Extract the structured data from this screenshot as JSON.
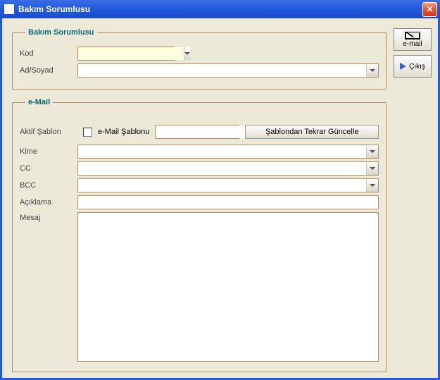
{
  "window": {
    "title": "Bakım Sorumlusu"
  },
  "group_top": {
    "legend": "Bakım Sorumlusu",
    "kod_label": "Kod",
    "kod_value": "",
    "adsoyad_label": "Ad/Soyad",
    "adsoyad_value": ""
  },
  "group_email": {
    "legend": "e-Mail",
    "aktif_sablon_label": "Aktif Şablon",
    "email_sablonu_label": "e-Mail Şablonu",
    "sablon_value": "",
    "refresh_button": "Şablondan Tekrar Güncelle",
    "kime_label": "Kime",
    "kime_value": "",
    "cc_label": "CC",
    "cc_value": "",
    "bcc_label": "BCC",
    "bcc_value": "",
    "aciklama_label": "Açıklama",
    "aciklama_value": "",
    "mesaj_label": "Mesaj",
    "mesaj_value": ""
  },
  "side": {
    "email_label": "e-mail",
    "exit_label": "Çıkış"
  }
}
